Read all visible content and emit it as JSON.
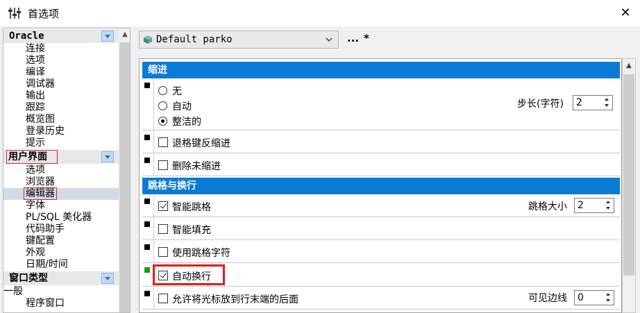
{
  "window": {
    "title": "首选项"
  },
  "nav": {
    "groups": [
      {
        "label": "Oracle",
        "items": [
          "连接",
          "选项",
          "编译",
          "调试器",
          "输出",
          "跟踪",
          "概览图",
          "登录历史",
          "提示"
        ]
      },
      {
        "label": "用户界面",
        "items": [
          "选项",
          "浏览器",
          "编辑器",
          "字体",
          "PL/SQL 美化器",
          "代码助手",
          "键配置",
          "外观",
          "日期/时间"
        ]
      },
      {
        "label": "窗口类型",
        "items": [
          "一般",
          "程序窗口"
        ]
      }
    ]
  },
  "profile": {
    "selected": "Default parko",
    "more_label": "...",
    "star_label": "*"
  },
  "sections": {
    "indent": {
      "title": "缩进",
      "radio_options": [
        "无",
        "自动",
        "整洁的"
      ],
      "selected_option": "整洁的",
      "step_label": "步长(字符)",
      "step_value": "2",
      "backspace_unindent": "退格键反缩进",
      "delete_unindent": "删除未缩进"
    },
    "tabs": {
      "title": "跳格与换行",
      "smart_tab": "智能跳格",
      "tab_size_label": "跳格大小",
      "tab_size_value": "2",
      "smart_fill": "智能填充",
      "use_tab_char": "使用跳格字符",
      "auto_wrap": "自动换行",
      "allow_cursor_after_eol": "允许将光标放到行末端的后面",
      "visible_margin_label": "可见边线",
      "visible_margin_value": "0"
    }
  },
  "checkbox_states": {
    "backspace_unindent": false,
    "delete_unindent": false,
    "smart_tab": true,
    "smart_fill": false,
    "use_tab_char": false,
    "auto_wrap": true,
    "allow_cursor_after_eol": false
  },
  "colors": {
    "section_header": "#0a7ad4",
    "highlight": "#e81818",
    "changed_marker": "#1a9a1a"
  }
}
